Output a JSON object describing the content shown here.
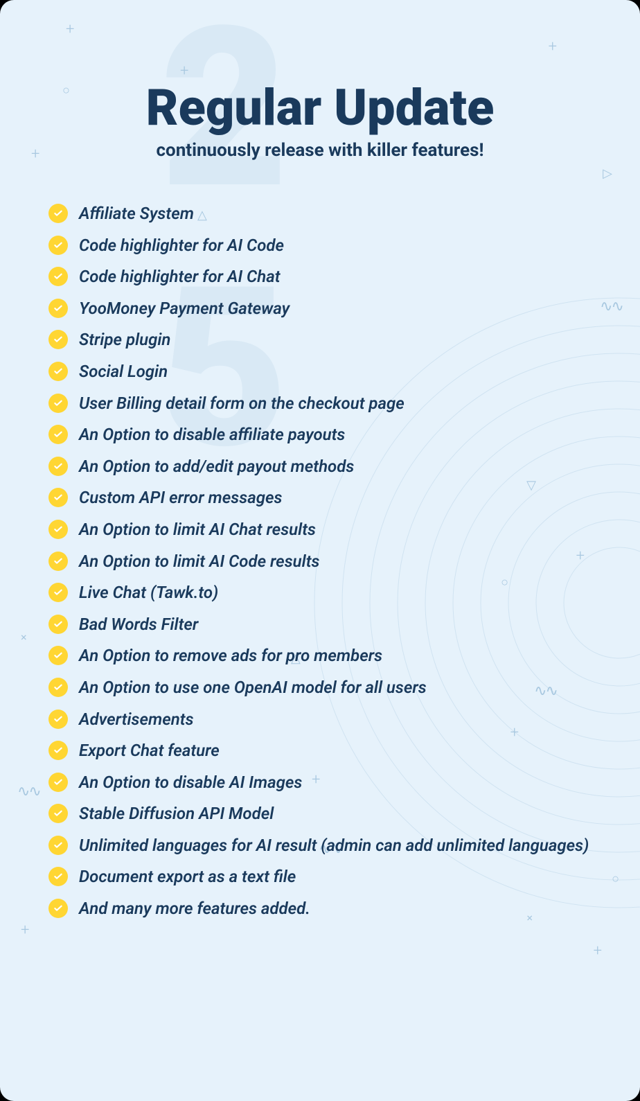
{
  "bg_number": "2 5",
  "title": "Regular Update",
  "subtitle": "continuously release with killer features!",
  "features": [
    "Affiliate System",
    "Code highlighter for AI Code",
    "Code highlighter for AI Chat",
    "YooMoney Payment Gateway",
    "Stripe plugin",
    "Social Login",
    "User Billing detail form on the checkout page",
    "An Option to disable affiliate payouts",
    "An Option to add/edit payout methods",
    "Custom API error messages",
    "An Option to limit AI Chat results",
    "An Option to limit AI Code results",
    "Live Chat (Tawk.to)",
    "Bad Words Filter",
    "An Option to remove ads for pro members",
    "An Option to use one OpenAI model for all users",
    "Advertisements",
    "Export Chat feature",
    "An Option to disable AI Images",
    "Stable Diffusion API Model",
    "Unlimited languages for AI result (admin can add unlimited languages)",
    "Document export as a text file",
    "And many more features added."
  ]
}
